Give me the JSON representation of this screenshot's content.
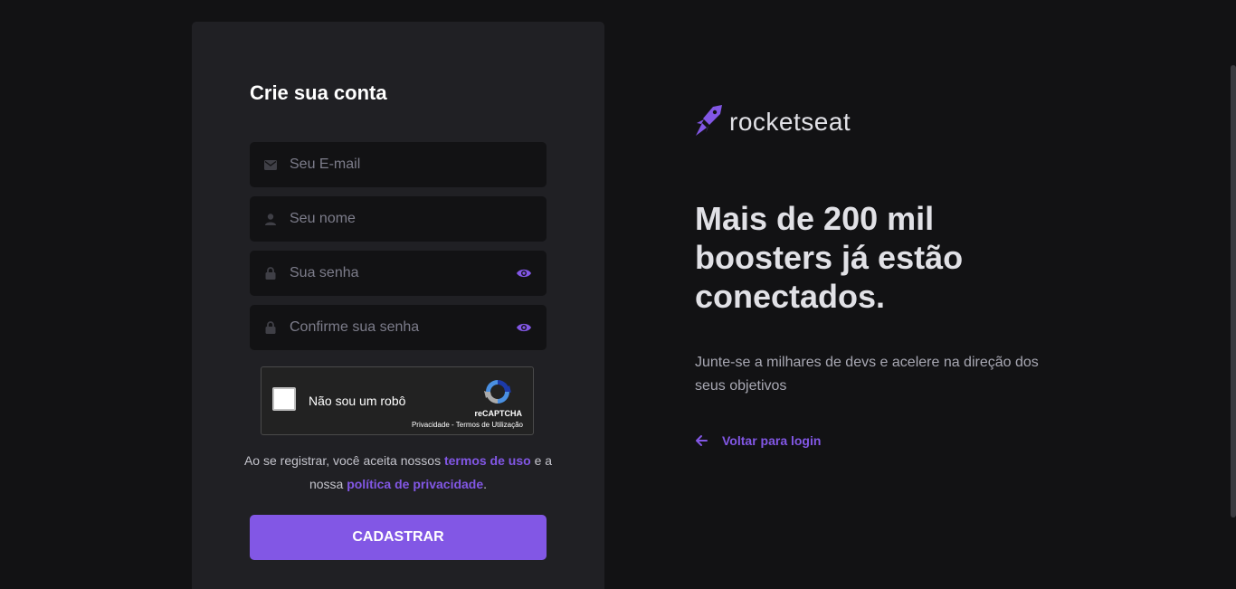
{
  "form": {
    "title": "Crie sua conta",
    "fields": [
      {
        "name": "email",
        "placeholder": "Seu E-mail",
        "icon": "mail-icon"
      },
      {
        "name": "name",
        "placeholder": "Seu nome",
        "icon": "user-icon"
      },
      {
        "name": "password",
        "placeholder": "Sua senha",
        "icon": "lock-icon",
        "toggle_icon": "eye-icon"
      },
      {
        "name": "password_confirm",
        "placeholder": "Confirme sua senha",
        "icon": "lock-icon",
        "toggle_icon": "eye-icon"
      }
    ],
    "captcha": {
      "label": "Não sou um robô",
      "brand": "reCAPTCHA",
      "privacy": "Privacidade",
      "separator": " - ",
      "terms": "Termos de Utilização"
    },
    "terms": {
      "prefix": "Ao se registrar, você aceita nossos",
      "terms_link": "termos de uso",
      "middle": "e a nossa",
      "privacy_link": "política de privacidade",
      "suffix": "."
    },
    "submit_label": "CADASTRAR"
  },
  "side": {
    "brand_name": "rocketseat",
    "headline": "Mais de 200 mil boosters já estão conectados.",
    "description": "Junte-se a milhares de devs e acelere na direção dos seus objetivos",
    "back_link": "Voltar para login"
  },
  "colors": {
    "background": "#121214",
    "card": "#202024",
    "input": "#121214",
    "accent": "#8257e5",
    "text": "#e1e1e6",
    "muted": "#a8a8b3"
  }
}
